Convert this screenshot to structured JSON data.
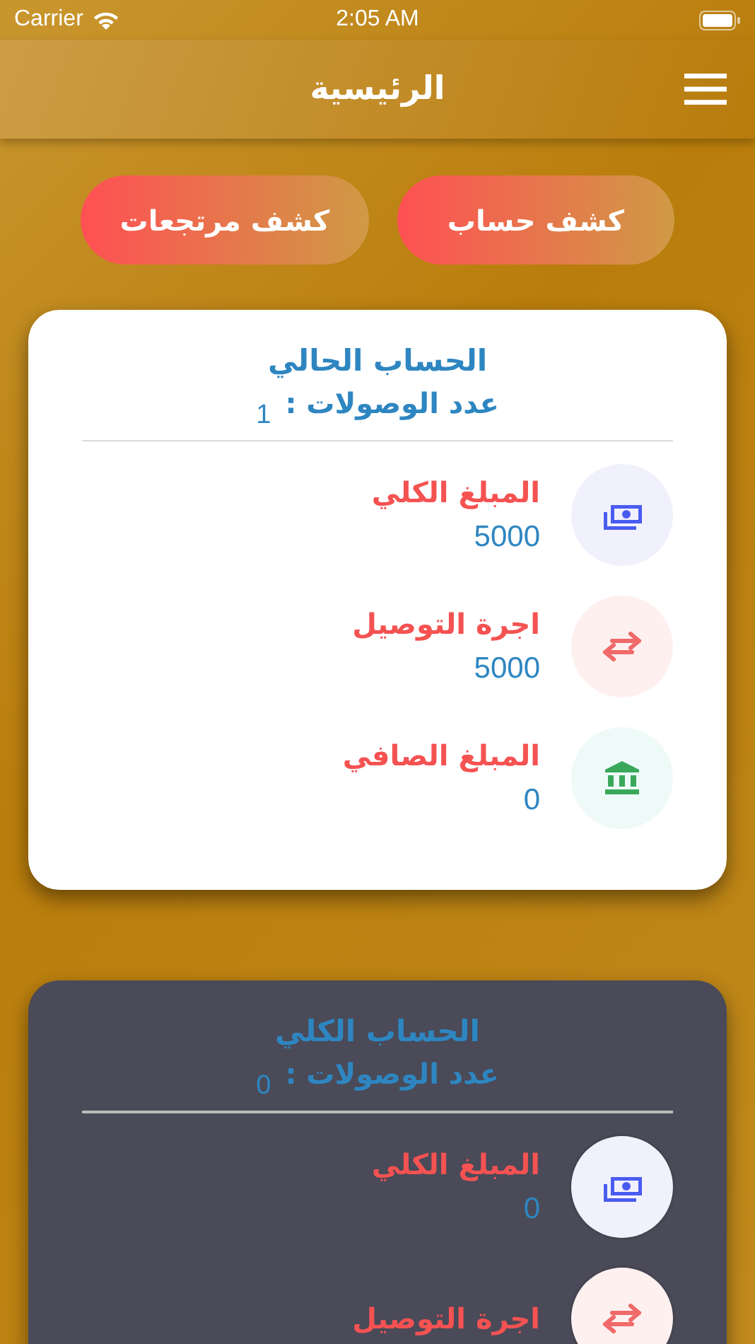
{
  "status_bar": {
    "carrier": "Carrier",
    "time": "2:05 AM"
  },
  "nav": {
    "title": "الرئيسية"
  },
  "actions": [
    "كشف حساب",
    "كشف مرتجعات"
  ],
  "cards": [
    {
      "kind": "light",
      "title": "الحساب الحالي",
      "count_label": "عدد الوصولات :",
      "count": "1",
      "items": [
        {
          "kind": "money",
          "label": "المبلغ الكلي",
          "value": "5000"
        },
        {
          "kind": "transfer",
          "label": "اجرة التوصيل",
          "value": "5000"
        },
        {
          "kind": "bank",
          "label": "المبلغ الصافي",
          "value": "0"
        }
      ]
    },
    {
      "kind": "dark",
      "title": "الحساب الكلي",
      "count_label": "عدد الوصولات :",
      "count": "0",
      "items": [
        {
          "kind": "money",
          "label": "المبلغ الكلي",
          "value": "0"
        },
        {
          "kind": "transfer",
          "label": "اجرة التوصيل"
        }
      ]
    }
  ]
}
